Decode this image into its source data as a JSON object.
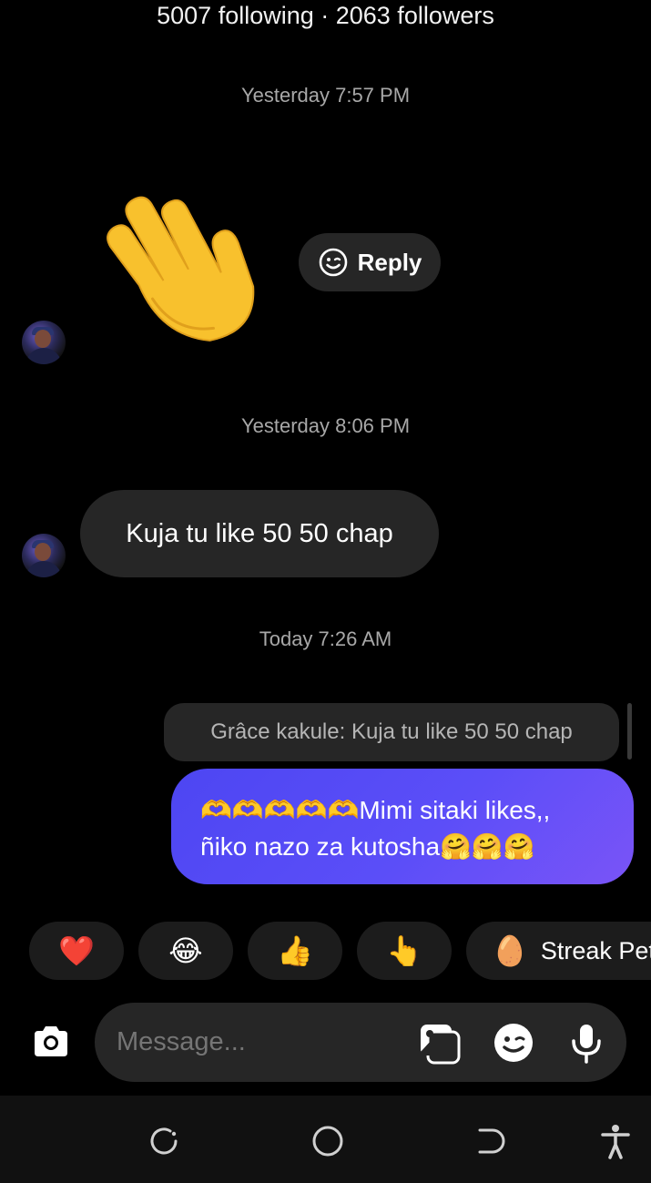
{
  "header": {
    "follow_stats": "5007 following · 2063 followers"
  },
  "thread": {
    "timestamps": [
      "Yesterday 7:57 PM",
      "Yesterday 8:06 PM",
      "Today 7:26 AM"
    ],
    "reply_button_label": "Reply",
    "incoming_message": "Kuja tu like 50 50 chap",
    "quoted_reply": "Grâce kakule: Kuja tu like 50 50 chap",
    "outgoing_message_line1": "🫶🫶🫶🫶🫶Mimi sitaki likes,,",
    "outgoing_message_line2": "ñiko nazo za kutosha🤗🤗🤗"
  },
  "quick_reactions": [
    {
      "emoji": "❤️",
      "icon": "red-heart"
    },
    {
      "emoji": "😂",
      "icon": "tears-of-joy"
    },
    {
      "emoji": "👍",
      "icon": "thumbs-up"
    },
    {
      "emoji": "👆",
      "icon": "pointing-up"
    },
    {
      "emoji": "🥚",
      "icon": "egg",
      "label": "Streak Pet"
    }
  ],
  "composer": {
    "placeholder": "Message..."
  },
  "colors": {
    "background": "#000000",
    "bubble_incoming": "#262626",
    "bubble_outgoing_start": "#4d46f2",
    "bubble_outgoing_end": "#7a54f7",
    "timestamp": "#a8a8a8"
  }
}
